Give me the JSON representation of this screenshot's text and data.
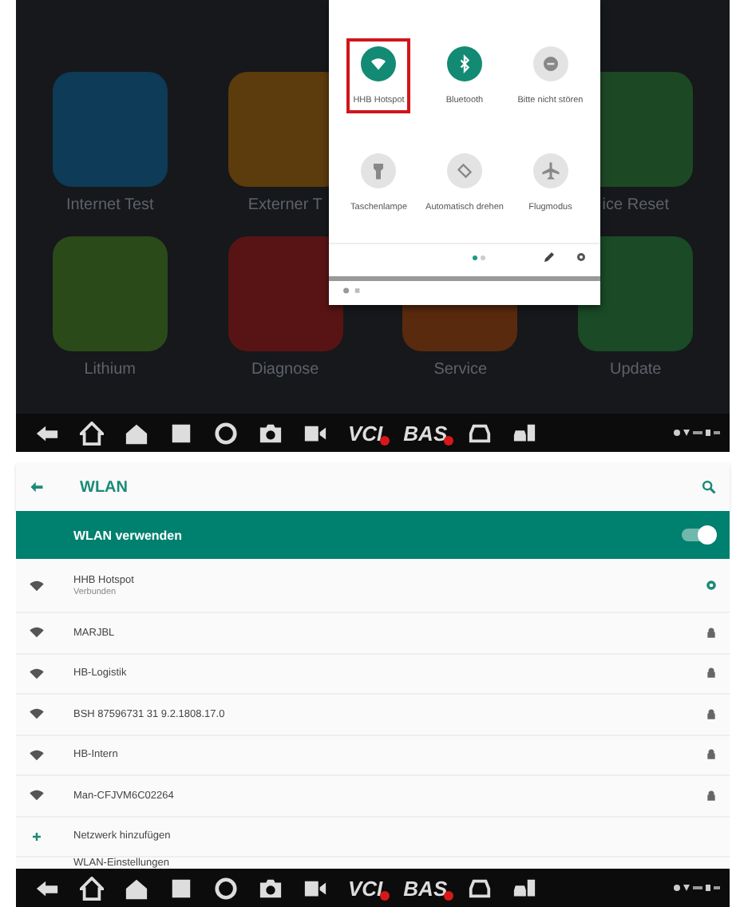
{
  "home_screen": {
    "apps": [
      {
        "label": "Internet Test",
        "color": "#0d3b58"
      },
      {
        "label": "Externer T",
        "color": "#5c3b0c"
      },
      {
        "label": "ice Reset",
        "color": "#1d4824"
      },
      {
        "label": "Lithium",
        "color": "#2a4a1a"
      },
      {
        "label": "Diagnose",
        "color": "#581414"
      },
      {
        "label": "Service",
        "color": "#5a2a0e"
      },
      {
        "label": "Update",
        "color": "#1a4a26"
      }
    ],
    "nav_bar": {
      "labels": [
        "VCI",
        "BAS"
      ]
    }
  },
  "quick_settings": {
    "tiles": [
      {
        "label": "HHB Hotspot",
        "on": true,
        "highlighted": true,
        "kind": "hotspot"
      },
      {
        "label": "Bluetooth",
        "on": true,
        "highlighted": false,
        "kind": "bluetooth"
      },
      {
        "label": "Bitte nicht stören",
        "on": false,
        "highlighted": false,
        "kind": "dnd"
      },
      {
        "label": "Taschenlampe",
        "on": false,
        "highlighted": false,
        "kind": "flashlight"
      },
      {
        "label": "Automatisch drehen",
        "on": false,
        "highlighted": false,
        "kind": "rotate"
      },
      {
        "label": "Flugmodus",
        "on": false,
        "highlighted": false,
        "kind": "airplane"
      }
    ]
  },
  "wlan": {
    "title": "WLAN",
    "master_switch": {
      "label": "WLAN verwenden",
      "on": true
    },
    "networks": [
      {
        "name": "HHB Hotspot",
        "status": "Verbunden",
        "kind": "connected"
      },
      {
        "name": "MARJBL",
        "kind": "secured"
      },
      {
        "name": "HB-Logistik",
        "kind": "secured"
      },
      {
        "name": "BSH 87596731 31 9.2.1808.17.0",
        "kind": "secured"
      },
      {
        "name": "HB-Intern",
        "kind": "secured"
      },
      {
        "name": "Man-CFJVM6C02264",
        "kind": "secured"
      },
      {
        "name": "Netzwerk hinzufügen",
        "kind": "add"
      },
      {
        "name": "WLAN-Einstellungen",
        "kind": "settings"
      }
    ],
    "nav_bar": {
      "labels": [
        "VCI",
        "BAS"
      ]
    }
  }
}
